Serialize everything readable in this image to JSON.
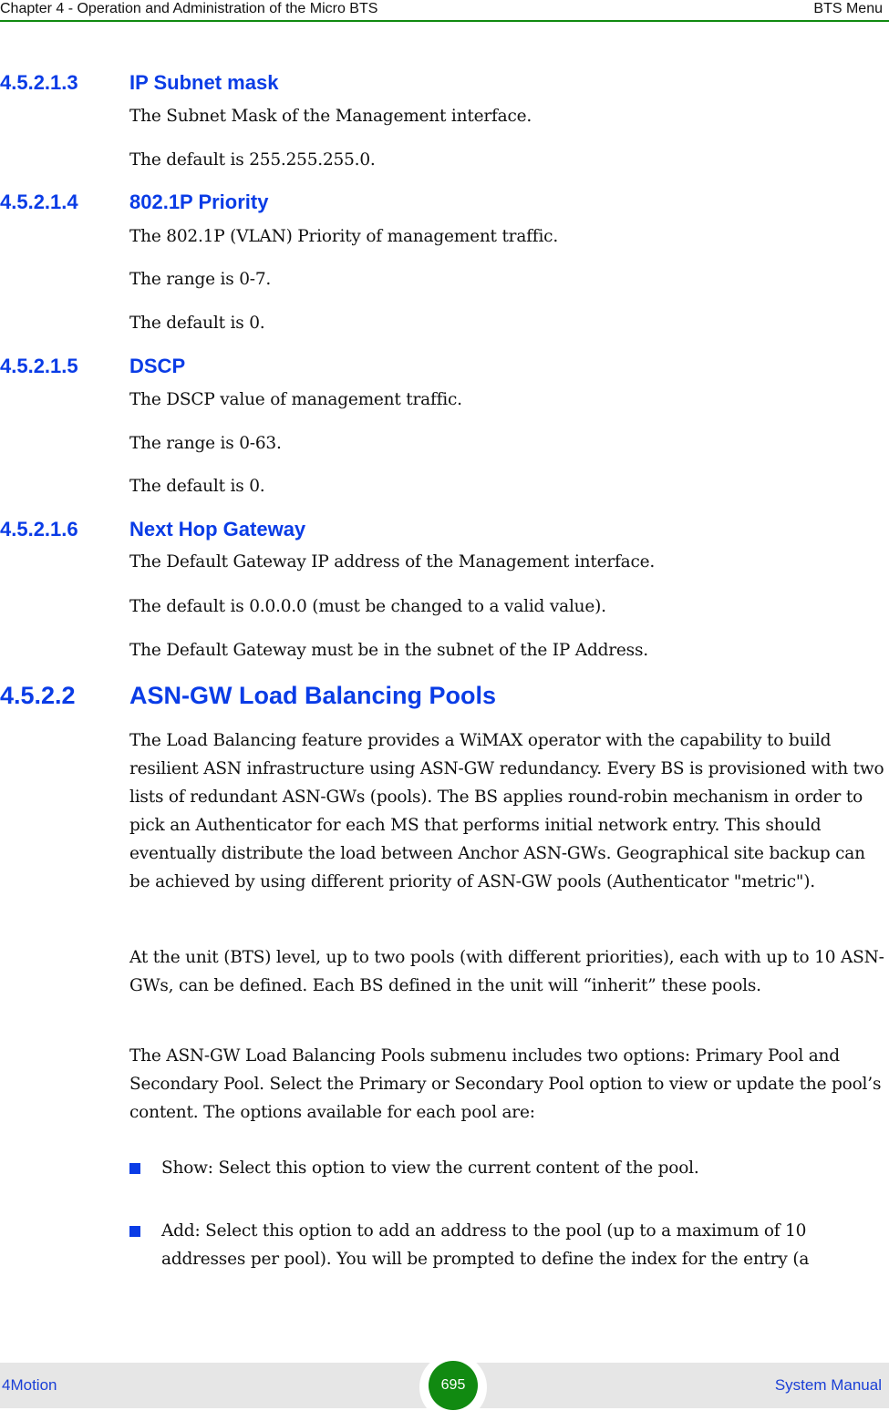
{
  "header": {
    "chapter": "Chapter 4 - Operation and Administration of the Micro BTS",
    "section": "BTS Menu"
  },
  "sections": [
    {
      "number": "4.5.2.1.3",
      "title": "IP Subnet mask",
      "paragraphs": [
        "The Subnet Mask of the Management interface.",
        "The default is 255.255.255.0."
      ]
    },
    {
      "number": "4.5.2.1.4",
      "title": "802.1P Priority",
      "paragraphs": [
        "The 802.1P (VLAN) Priority of management traffic.",
        "The range is 0-7.",
        "The default is 0."
      ]
    },
    {
      "number": "4.5.2.1.5",
      "title": "DSCP",
      "paragraphs": [
        "The DSCP value of management traffic.",
        "The range is 0-63.",
        "The default is 0."
      ]
    },
    {
      "number": "4.5.2.1.6",
      "title": "Next Hop Gateway",
      "paragraphs": [
        "The Default Gateway IP address of the Management interface.",
        "The default is 0.0.0.0 (must be changed to a valid value).",
        "The Default Gateway must be in the subnet of the IP Address."
      ]
    }
  ],
  "main_section": {
    "number": "4.5.2.2",
    "title": "ASN-GW Load Balancing Pools",
    "paragraphs": [
      "The Load Balancing feature provides a WiMAX operator with the capability to build resilient ASN infrastructure using ASN-GW redundancy. Every BS is provisioned with two lists of redundant ASN-GWs (pools). The BS applies round-robin mechanism in order to pick an Authenticator for each MS that performs initial network entry. This should eventually distribute the load between Anchor ASN-GWs. Geographical site backup can be achieved by using different priority of ASN-GW pools (Authenticator \"metric\").",
      "At the unit (BTS) level, up to two pools (with different priorities), each with up to 10 ASN-GWs, can be defined. Each BS defined in the unit will “inherit” these pools.",
      "The ASN-GW Load Balancing Pools submenu includes two options: Primary Pool and Secondary Pool. Select the Primary or Secondary Pool option to view or update the pool’s content. The options available for each pool are:"
    ],
    "bullets": [
      "Show: Select this option to view the current content of the pool.",
      "Add: Select this option to add an address to the pool (up to a maximum of 10 addresses per pool). You will be prompted to define the index for the entry (a"
    ]
  },
  "footer": {
    "product": "4Motion",
    "page_number": "695",
    "manual": "System Manual"
  },
  "colors": {
    "heading": "#0a3ce6",
    "rule": "#118a11",
    "page_badge": "#118a11",
    "footer_bg": "#e6e6e6",
    "footer_text": "#1a3fd6"
  }
}
